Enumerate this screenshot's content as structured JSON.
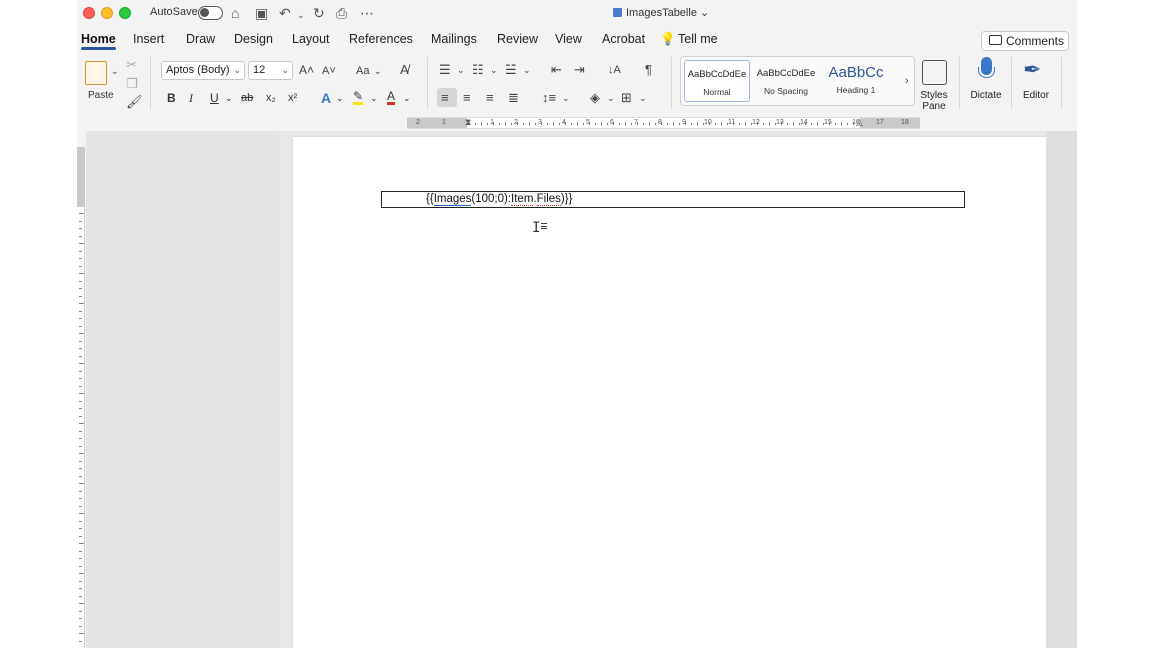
{
  "titlebar": {
    "autosave_label": "AutoSave",
    "doc_title": "ImagesTabelle",
    "icons": [
      "home-icon",
      "save-icon",
      "undo-icon",
      "redo-icon",
      "print-icon",
      "more-icon"
    ]
  },
  "tabs": [
    {
      "label": "Home",
      "active": true
    },
    {
      "label": "Insert"
    },
    {
      "label": "Draw"
    },
    {
      "label": "Design"
    },
    {
      "label": "Layout"
    },
    {
      "label": "References"
    },
    {
      "label": "Mailings"
    },
    {
      "label": "Review"
    },
    {
      "label": "View"
    },
    {
      "label": "Acrobat"
    },
    {
      "label": "Tell me"
    }
  ],
  "comments_label": "Comments",
  "ribbon": {
    "paste_label": "Paste",
    "font_name": "Aptos (Body)",
    "font_size": "12",
    "change_case": "Aa",
    "format_buttons": [
      "B",
      "I",
      "U",
      "ab",
      "x₂",
      "x²"
    ],
    "styles": [
      {
        "preview": "AaBbCcDdEe",
        "name": "Normal",
        "selected": true
      },
      {
        "preview": "AaBbCcDdEe",
        "name": "No Spacing"
      },
      {
        "preview": "AaBbCc",
        "name": "Heading 1"
      }
    ],
    "styles_pane_line1": "Styles",
    "styles_pane_line2": "Pane",
    "dictate_label": "Dictate",
    "editor_label": "Editor"
  },
  "ruler": {
    "numbers": [
      "2",
      "1",
      "1",
      "2",
      "3",
      "4",
      "5",
      "6",
      "7",
      "8",
      "9",
      "10",
      "11",
      "12",
      "13",
      "14",
      "15",
      "16",
      "17",
      "18"
    ]
  },
  "document": {
    "field_prefix": "{{",
    "field_images": "Images",
    "field_middle": "(100;0):",
    "field_item": "Item",
    "field_dot": ".",
    "field_files": "Files",
    "field_suffix": ")}}"
  },
  "colors": {
    "accent": "#2b579a",
    "traffic_red": "#fe5f57",
    "traffic_yellow": "#febc2e",
    "traffic_green": "#28c840"
  }
}
